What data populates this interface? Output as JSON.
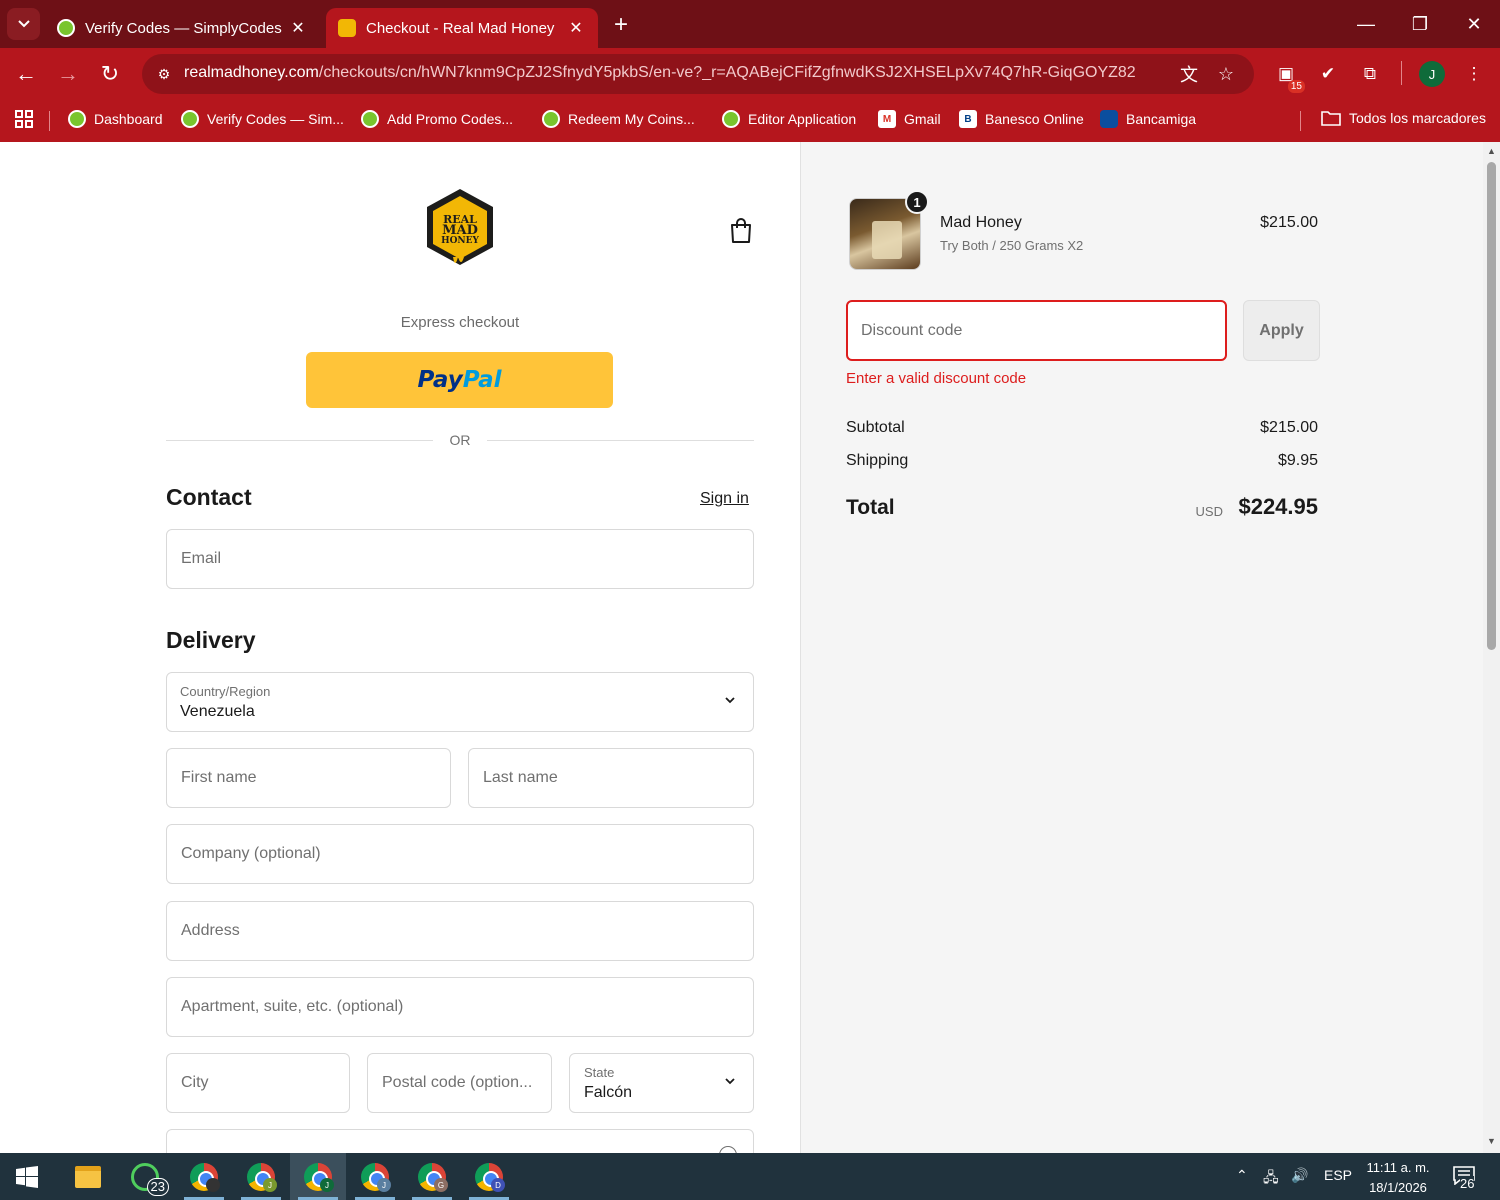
{
  "browser": {
    "tabs": [
      {
        "title": "Verify Codes — SimplyCodes",
        "active": false
      },
      {
        "title": "Checkout - Real Mad Honey",
        "active": true
      }
    ],
    "url_host": "realmadhoney.com",
    "url_path": "/checkouts/cn/hWN7knm9CpZJ2SfnydY5pkbS/en-ve?_r=AQABejCFifZgfnwdKSJ2XHSELpXv74Q7hR-GiqGOYZ82",
    "extension_badge": "15",
    "profile_initial": "J",
    "bookmarks": [
      {
        "label": "Dashboard",
        "icon": "simplycodes-icon"
      },
      {
        "label": "Verify Codes — Sim...",
        "icon": "simplycodes-icon"
      },
      {
        "label": "Add Promo Codes...",
        "icon": "simplycodes-icon"
      },
      {
        "label": "Redeem My Coins...",
        "icon": "simplycodes-icon"
      },
      {
        "label": "Editor Application",
        "icon": "simplycodes-icon"
      },
      {
        "label": "Gmail",
        "icon": "gmail-icon"
      },
      {
        "label": "Banesco Online",
        "icon": "banesco-icon"
      },
      {
        "label": "Bancamiga",
        "icon": "bancamiga-icon"
      }
    ],
    "all_bookmarks": "Todos los marcadores"
  },
  "checkout": {
    "logo_lines": [
      "REAL",
      "MAD",
      "HONEY"
    ],
    "express_checkout": "Express checkout",
    "paypal_pay": "Pay",
    "paypal_pal": "Pal",
    "or": "OR",
    "contact_heading": "Contact",
    "sign_in": "Sign in",
    "email_placeholder": "Email",
    "delivery_heading": "Delivery",
    "country_label": "Country/Region",
    "country_value": "Venezuela",
    "first_name_placeholder": "First name",
    "last_name_placeholder": "Last name",
    "company_placeholder": "Company (optional)",
    "address_placeholder": "Address",
    "apartment_placeholder": "Apartment, suite, etc. (optional)",
    "city_placeholder": "City",
    "postal_placeholder": "Postal code (option...",
    "state_label": "State",
    "state_value": "Falcón"
  },
  "summary": {
    "product_name": "Mad Honey",
    "product_variant": "Try Both / 250 Grams X2",
    "product_price": "$215.00",
    "quantity": "1",
    "discount_placeholder": "Discount code",
    "apply_label": "Apply",
    "discount_error": "Enter a valid discount code",
    "subtotal_label": "Subtotal",
    "subtotal_value": "$215.00",
    "shipping_label": "Shipping",
    "shipping_value": "$9.95",
    "total_label": "Total",
    "currency": "USD",
    "total_value": "$224.95"
  },
  "taskbar": {
    "whatsapp_badge": "23",
    "chrome_profiles": [
      "",
      "J",
      "J",
      "J",
      "G",
      "D"
    ],
    "language": "ESP",
    "time": "11:11 a. m.",
    "date": "18/1/2026",
    "notification_count": "26"
  },
  "colors": {
    "tabbar": "#6e1016",
    "toolbar": "#b5161d",
    "paypal_yellow": "#ffc439",
    "error_red": "#dd1d1d",
    "taskbar": "#20323d"
  }
}
